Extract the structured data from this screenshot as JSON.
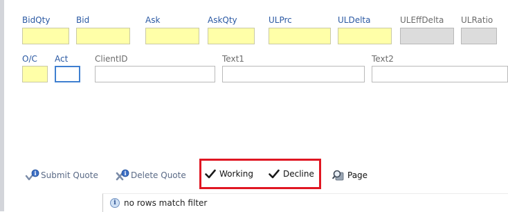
{
  "fields_row1": [
    {
      "key": "bidqty",
      "label": "BidQty"
    },
    {
      "key": "bid",
      "label": "Bid"
    },
    {
      "key": "ask",
      "label": "Ask"
    },
    {
      "key": "askqty",
      "label": "AskQty"
    },
    {
      "key": "ulprc",
      "label": "ULPrc"
    },
    {
      "key": "uldelta",
      "label": "ULDelta"
    },
    {
      "key": "uleffdelta",
      "label": "ULEffDelta"
    },
    {
      "key": "ulratio",
      "label": "ULRatio"
    }
  ],
  "fields_row2": [
    {
      "key": "oc",
      "label": "O/C"
    },
    {
      "key": "act",
      "label": "Act"
    },
    {
      "key": "clientid",
      "label": "ClientID"
    },
    {
      "key": "text1",
      "label": "Text1"
    },
    {
      "key": "text2",
      "label": "Text2"
    }
  ],
  "toolbar": {
    "submit_quote": "Submit Quote",
    "delete_quote": "Delete Quote",
    "working": "Working",
    "decline": "Decline",
    "page": "Page"
  },
  "status": {
    "message": "no rows match filter"
  },
  "colors": {
    "label_blue": "#2b59a3",
    "field_yellow": "#ffffa8",
    "field_grey": "#dcdcdc",
    "highlight_red": "#e01622",
    "check_dark": "#1a1a1a"
  }
}
